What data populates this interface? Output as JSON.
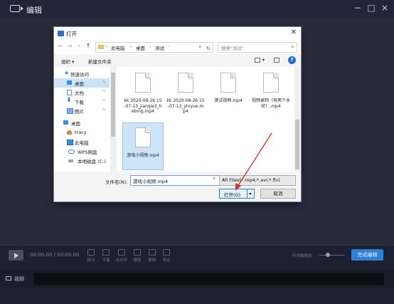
{
  "app": {
    "title": "编辑",
    "window_controls": [
      "−",
      "□",
      "×"
    ]
  },
  "dialog": {
    "title": "打开",
    "close": "✕",
    "nav_buttons": [
      "←",
      "→",
      "∨",
      "↑"
    ],
    "breadcrumb": [
      "此电脑",
      "桌面",
      "测试"
    ],
    "search_placeholder": "搜索\"测试\"",
    "commands": {
      "organize": "组织 ▾",
      "new_folder": "新建文件夹",
      "help": "?"
    },
    "sidebar": [
      {
        "label": "快速访问",
        "icon": "star-icon",
        "pinned": false
      },
      {
        "label": "桌面",
        "icon": "desktop-icon",
        "pinned": true,
        "selected": true
      },
      {
        "label": "文档",
        "icon": "documents-icon",
        "pinned": true
      },
      {
        "label": "下载",
        "icon": "download-icon",
        "pinned": true
      },
      {
        "label": "图片",
        "icon": "pictures-icon",
        "pinned": true
      },
      {
        "label": "桌面",
        "icon": "desktop-icon",
        "pinned": false
      },
      {
        "label": "tracy",
        "icon": "user-icon",
        "pinned": false
      },
      {
        "label": "此电脑",
        "icon": "computer-icon",
        "pinned": false
      },
      {
        "label": "WPS网盘",
        "icon": "cloud-icon",
        "pinned": false
      },
      {
        "label": "本地磁盘 (C:)",
        "icon": "disk-icon",
        "pinned": false
      }
    ],
    "files": [
      {
        "name": "kk 2020-08-26 15-07-13_jianqie3_hebing.mp4"
      },
      {
        "name": "kk 2020-08-26 15-07-13_yinyue.mp4"
      },
      {
        "name": "测试视频.mp4"
      },
      {
        "name": "视频录制（有两个水印）.mp4"
      },
      {
        "name": "游戏小视频.mp4",
        "selected": true
      }
    ],
    "filename_label": "文件名(N):",
    "filename_value": "游戏小视频.mp4",
    "filetype_value": "All Files(*.mp4;*.avi;*.flv)",
    "open_label": "打开(O)",
    "cancel_label": "取消"
  },
  "toolbar": {
    "timecode": "00:00.00 / 00:00.00",
    "tools": [
      "拆分",
      "字幕",
      "去水印",
      "撤销",
      "删除",
      "导出"
    ],
    "zoom_label": "时间轴缩放",
    "finish_label": "完成编辑"
  },
  "track": {
    "label": "视频"
  },
  "colors": {
    "accent": "#2f7fd8",
    "app_bg": "#282c3a",
    "selection": "#cce4f7",
    "arrow": "#e0302a"
  }
}
